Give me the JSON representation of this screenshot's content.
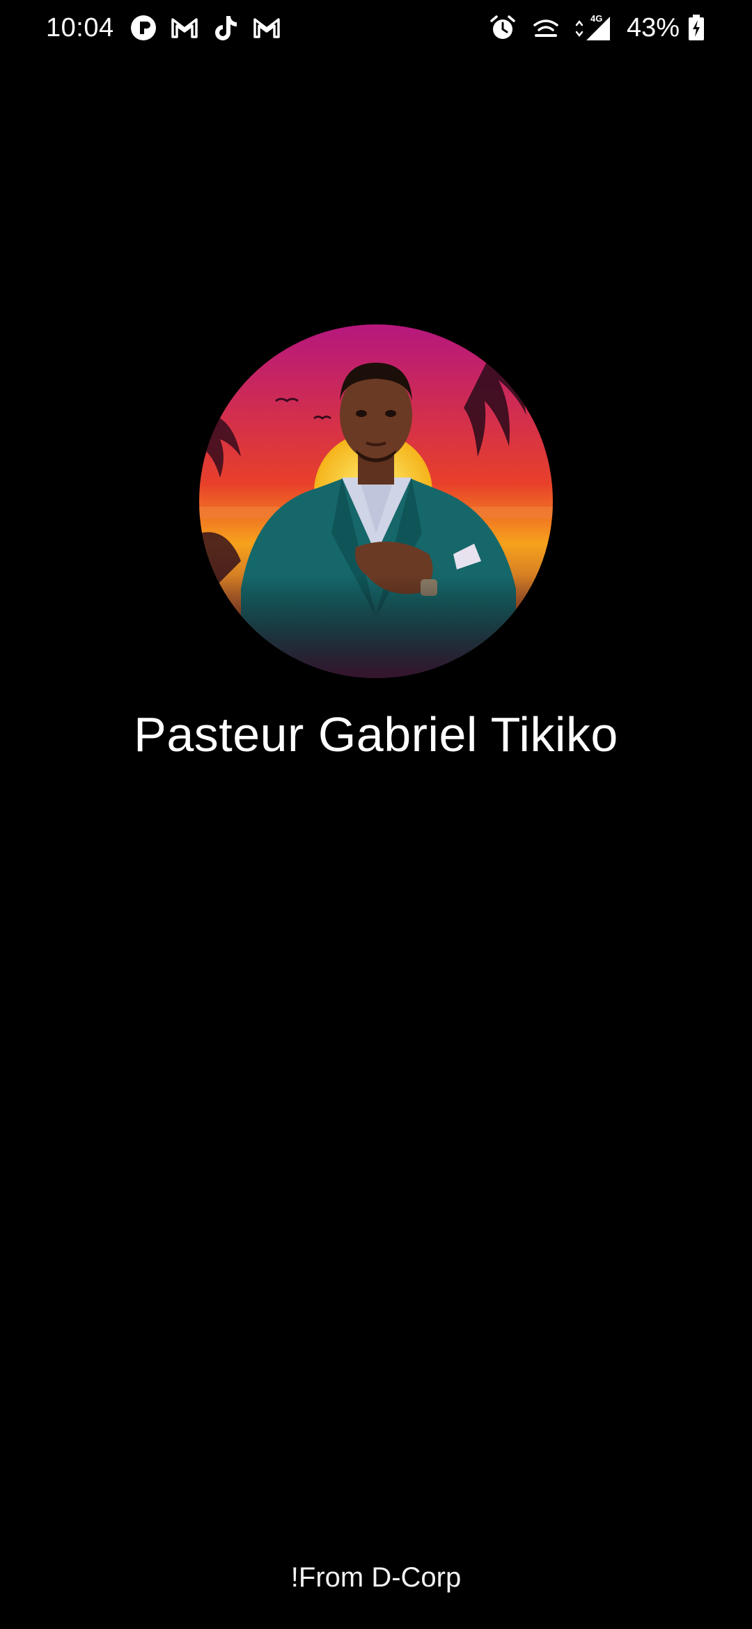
{
  "status_bar": {
    "time": "10:04",
    "notification_icons": [
      "messenger-icon",
      "gmail-icon",
      "tiktok-icon",
      "gmail-icon"
    ],
    "system_icons": [
      "alarm-icon",
      "hotspot-icon",
      "signal-4g-icon"
    ],
    "network_type": "4G",
    "battery_percent": "43%",
    "battery_charging": true
  },
  "splash": {
    "app_title": "Pasteur Gabriel Tikiko",
    "footer_credit": "!From D-Corp"
  },
  "theme": {
    "background": "#000000",
    "text": "#ffffff",
    "avatar_gradient": [
      "#b5177e",
      "#e8402a",
      "#f7a21c",
      "#f5d33a"
    ]
  }
}
